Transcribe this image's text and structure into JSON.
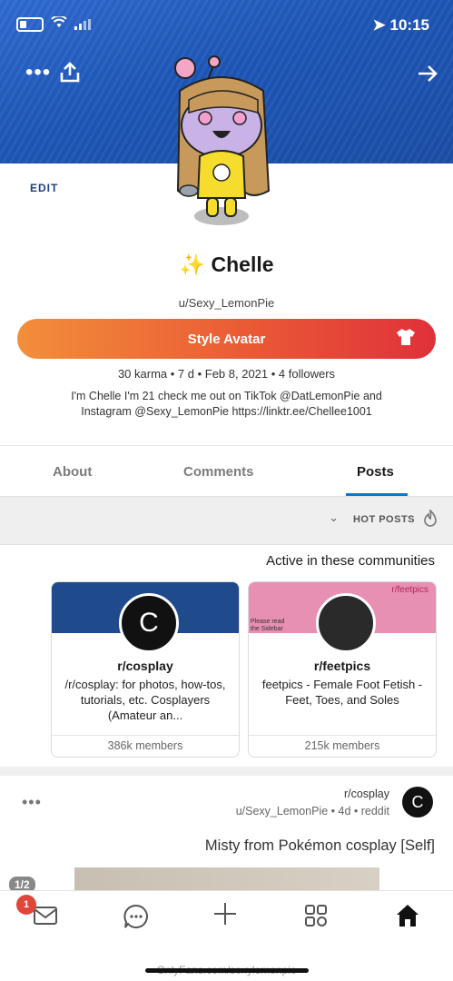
{
  "status": {
    "time": "10:15"
  },
  "header": {
    "more_label": "•••",
    "share_icon": "upload-icon",
    "arrow_icon": "arrow-right-icon"
  },
  "profile": {
    "edit_label": "EDIT",
    "display_name": "Chelle",
    "sparkle": "✨",
    "username": "u/Sexy_LemonPie",
    "style_avatar_label": "Style Avatar",
    "stats": "30 karma • 7 d • Feb 8, 2021 • 4 followers",
    "bio_line1": "I'm Chelle I'm 21  check me out on TikTok @DatLemonPie and",
    "bio_line2": "Instagram @Sexy_LemonPie  https://linktr.ee/Chellee1001"
  },
  "tabs": {
    "posts": "Posts",
    "comments": "Comments",
    "about": "About"
  },
  "sort": {
    "label": "HOT POSTS"
  },
  "communities": {
    "title": "Active in these communities",
    "cards": [
      {
        "name": "r/feetpics",
        "tag": "r/feetpics",
        "note": "Please read\nthe Sidebar",
        "description": "feetpics - Female Foot Fetish - Feet, Toes, and Soles",
        "members": "215k members"
      },
      {
        "name": "r/cosplay",
        "description": "/r/cosplay: for photos, how-tos, tutorials, etc. Cosplayers (Amateur an...",
        "members": "386k members"
      }
    ]
  },
  "post": {
    "subreddit": "r/cosplay",
    "meta": "u/Sexy_LemonPie • 4d • reddit",
    "title": "Misty from Pokémon cosplay [Self]",
    "badge": "1/2"
  },
  "nav": {
    "inbox_count": "1"
  },
  "watermark": "OnlyFans.com/sexylemonpie"
}
